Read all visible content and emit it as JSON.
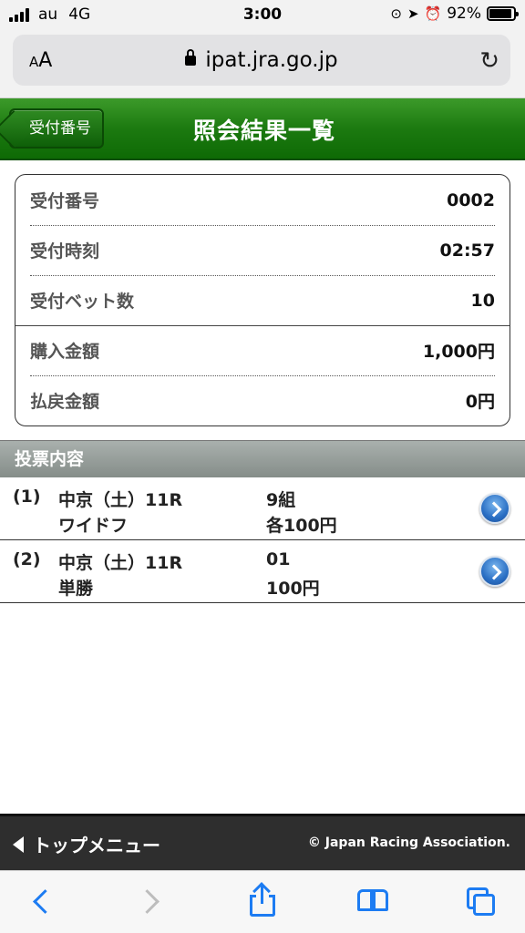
{
  "status_bar": {
    "carrier": "au",
    "network": "4G",
    "time": "3:00",
    "battery": "92%",
    "battery_level": 0.92
  },
  "browser": {
    "aa_label": "AA",
    "url": "ipat.jra.go.jp"
  },
  "header": {
    "back_label": "受付番号",
    "title": "照会結果一覧"
  },
  "receipt": {
    "rows": [
      {
        "label": "受付番号",
        "value": "0002"
      },
      {
        "label": "受付時刻",
        "value": "02:57"
      },
      {
        "label": "受付ベット数",
        "value": "10"
      },
      {
        "label": "購入金額",
        "value": "1,000円"
      },
      {
        "label": "払戻金額",
        "value": "0円"
      }
    ]
  },
  "section": {
    "title": "投票内容"
  },
  "votes": [
    {
      "num": "(1)",
      "race": "中京（土）11R",
      "type": "ワイドフ",
      "combo": "9組",
      "amount": "各100円"
    },
    {
      "num": "(2)",
      "race": "中京（土）11R",
      "type": "単勝",
      "combo": "01",
      "amount": "100円"
    }
  ],
  "footer": {
    "top_menu": "トップメニュー",
    "copyright": "© Japan Racing Association."
  },
  "colors": {
    "header_green": "#1c7a10",
    "section_gray": "#858d89",
    "footer_dark": "#2e2e2e",
    "ios_blue": "#1d7cf2"
  }
}
